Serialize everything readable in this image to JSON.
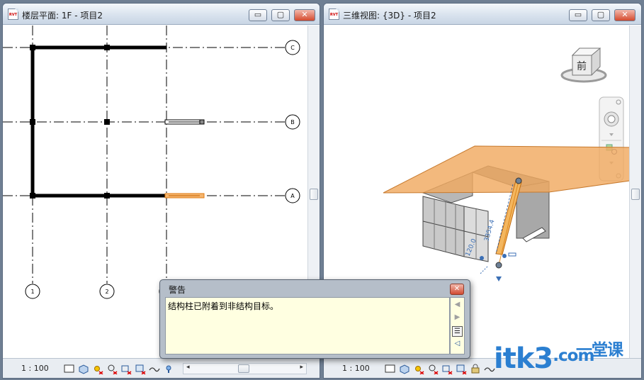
{
  "left_window": {
    "title": "楼层平面: 1F - 项目2",
    "app_badge": "RVT",
    "minimize_label": "▭",
    "maximize_label": "▢",
    "close_label": "✕",
    "grid_labels": {
      "row_c": "C",
      "row_b": "B",
      "row_a": "A",
      "col_1": "1",
      "col_2": "2"
    },
    "scale": "1 : 100"
  },
  "right_window": {
    "title": "三维视图: {3D} - 项目2",
    "app_badge": "RVT",
    "minimize_label": "▭",
    "maximize_label": "▢",
    "close_label": "✕",
    "viewcube_face": "前",
    "dimension_1": "120.0",
    "dimension_2": "3354.4",
    "scale": "1 : 100"
  },
  "warning_dialog": {
    "title": "警告",
    "message": "结构柱已附着到非结构目标。",
    "close_label": "✕"
  },
  "watermark": {
    "text": "itk3",
    "domain": ".com",
    "brand": "一堂课"
  },
  "colors": {
    "floor_orange": "#f0a960",
    "selection_orange": "#f08a24",
    "wall_gray": "#c9c9c9",
    "dialog_bg": "#ffffe1",
    "watermark_blue": "#2b7fd1"
  }
}
